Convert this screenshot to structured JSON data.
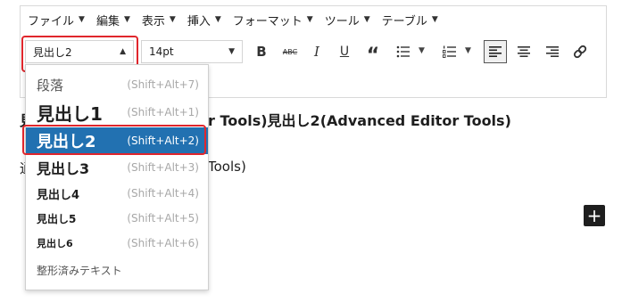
{
  "menubar": {
    "items": [
      "ファイル",
      "編集",
      "表示",
      "挿入",
      "フォーマット",
      "ツール",
      "テーブル"
    ]
  },
  "toolbar": {
    "block_format_value": "見出し2",
    "font_size_value": "14pt",
    "icons": [
      "bold-icon",
      "strikethrough-icon",
      "italic-icon",
      "underline-icon",
      "blockquote-icon",
      "bullet-list-icon",
      "numbered-list-icon",
      "align-left-icon",
      "align-center-icon",
      "align-right-icon",
      "link-icon"
    ]
  },
  "content": {
    "heading_visible": "r Tools)見出し2(Advanced Editor Tools)",
    "heading_edge": "見",
    "body_visible": "Tools)",
    "body_edge": "通"
  },
  "dropdown": {
    "items": [
      {
        "label": "段落",
        "shortcut": "(Shift+Alt+7)"
      },
      {
        "label": "見出し1",
        "shortcut": "(Shift+Alt+1)"
      },
      {
        "label": "見出し2",
        "shortcut": "(Shift+Alt+2)"
      },
      {
        "label": "見出し3",
        "shortcut": "(Shift+Alt+3)"
      },
      {
        "label": "見出し4",
        "shortcut": "(Shift+Alt+4)"
      },
      {
        "label": "見出し5",
        "shortcut": "(Shift+Alt+5)"
      },
      {
        "label": "見出し6",
        "shortcut": "(Shift+Alt+6)"
      },
      {
        "label": "整形済みテキスト",
        "shortcut": ""
      }
    ],
    "selected_index": 2
  },
  "colors": {
    "selected_bg": "#2271b1",
    "highlight": "#e0262c",
    "shortcut_text": "#a8a8a8"
  },
  "plus_button": {
    "label": "+"
  }
}
